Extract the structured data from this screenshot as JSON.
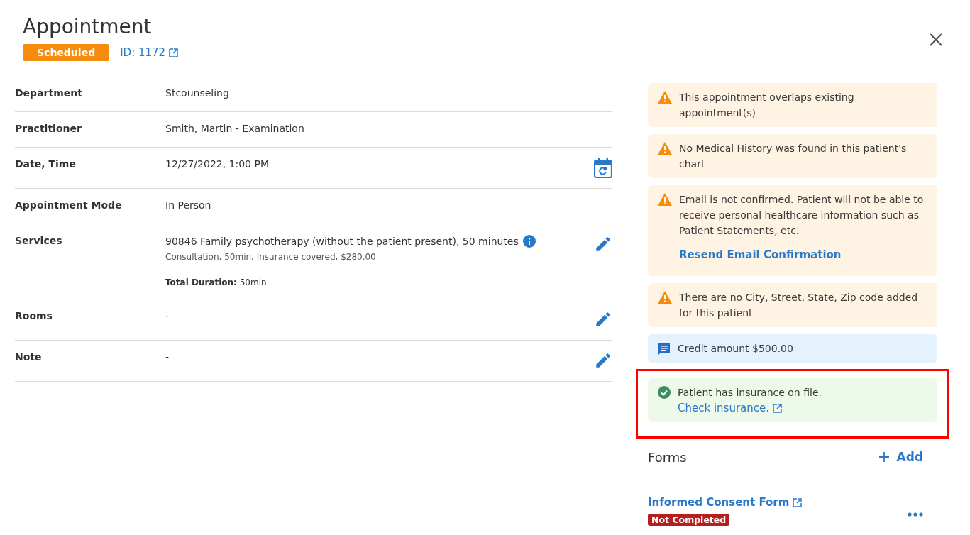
{
  "header": {
    "title": "Appointment",
    "status": "Scheduled",
    "id_link": "ID: 1172"
  },
  "details": [
    {
      "kind": "plain",
      "label": "Department",
      "value": "Stcounseling"
    },
    {
      "kind": "plain",
      "label": "Practitioner",
      "value": "Smith, Martin - Examination"
    },
    {
      "kind": "reschedule",
      "label": "Date, Time",
      "value": "12/27/2022, 1:00 PM"
    },
    {
      "kind": "plain",
      "label": "Appointment Mode",
      "value": "In Person"
    },
    {
      "kind": "edit",
      "label": "Services",
      "value": "90846 Family psychotherapy (without the patient present), 50 minutes",
      "info": true,
      "sub": "Consultation, 50min, Insurance covered, $280.00",
      "total": "**Total Duration:** 50min"
    },
    {
      "kind": "edit",
      "label": "Rooms",
      "value": "-"
    },
    {
      "kind": "edit",
      "label": "Note",
      "value": "-"
    }
  ],
  "alerts": [
    {
      "kind": "warning",
      "text": "This appointment overlaps existing appointment(s)"
    },
    {
      "kind": "warning",
      "text": "No Medical History was found in this patient's chart"
    },
    {
      "kind": "warning",
      "text": "Email is not confirmed. Patient will not be able to receive personal healthcare information such as Patient Statements, etc.",
      "action": "Resend Email Confirmation"
    },
    {
      "kind": "warning",
      "text": "There are no City, Street, State, Zip code added for this patient"
    },
    {
      "kind": "info",
      "text": "Credit amount $500.00"
    },
    {
      "kind": "success",
      "text": "Patient has insurance on file.",
      "link": "Check insurance.",
      "highlighted": true
    }
  ],
  "forms": {
    "title": "Forms",
    "add": "Add",
    "items": [
      {
        "name": "Informed Consent Form",
        "status": "Not Completed"
      }
    ]
  }
}
